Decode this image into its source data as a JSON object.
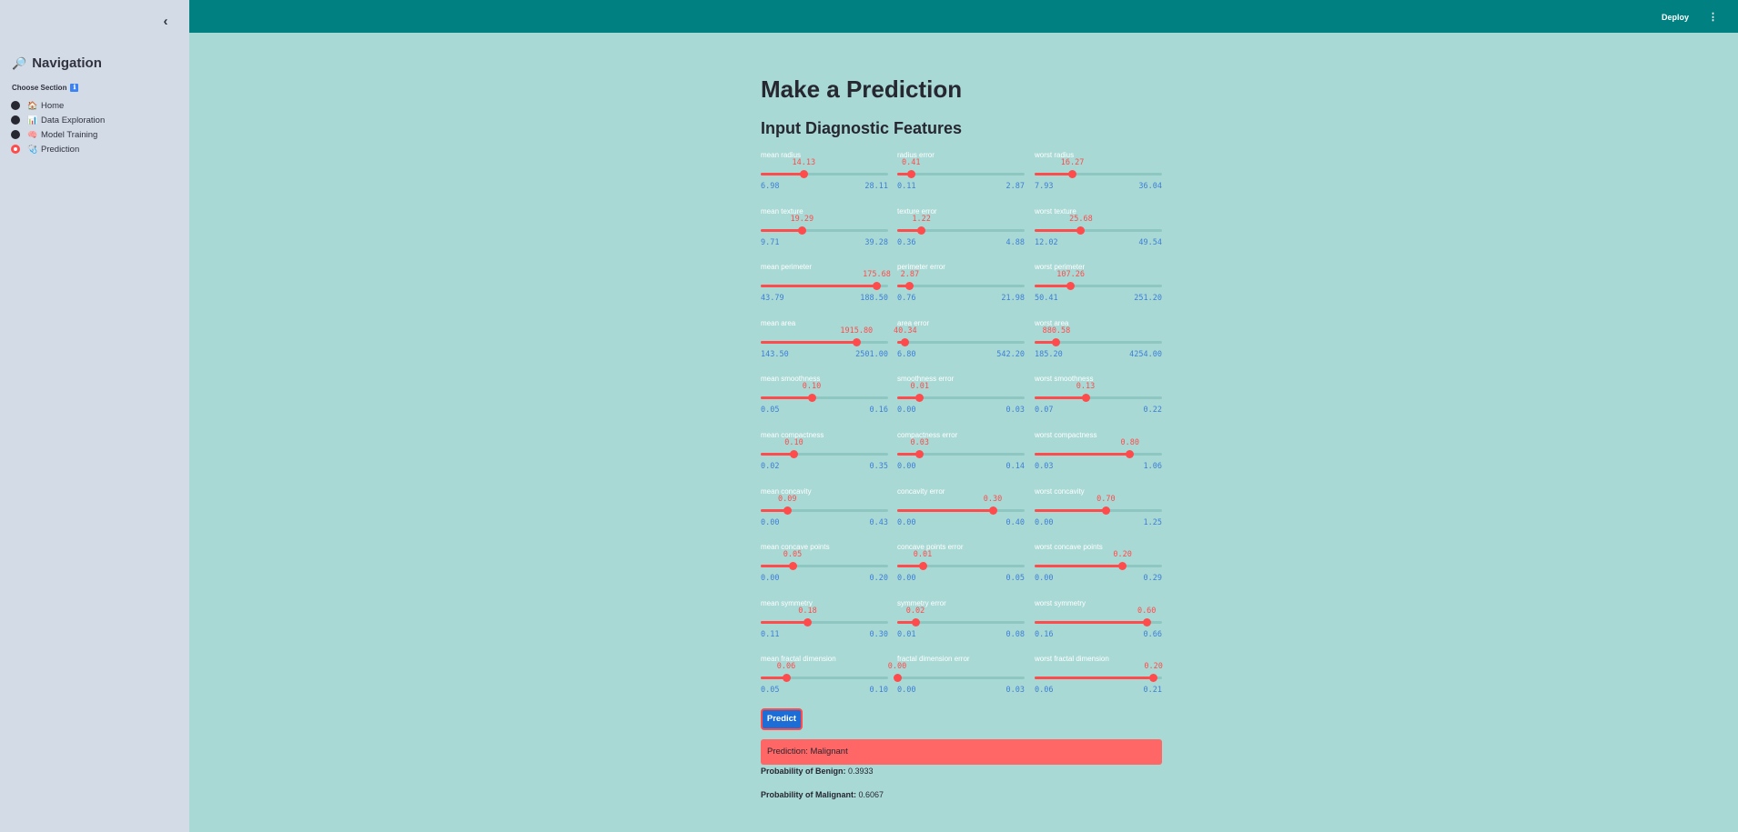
{
  "sidebar": {
    "title": "Navigation",
    "title_icon": "🔎",
    "section_label": "Choose Section",
    "section_badge": "ℹ",
    "items": [
      {
        "emoji": "🏠",
        "label": "Home",
        "active": false
      },
      {
        "emoji": "📊",
        "label": "Data Exploration",
        "active": false
      },
      {
        "emoji": "🧠",
        "label": "Model Training",
        "active": false
      },
      {
        "emoji": "🩺",
        "label": "Prediction",
        "active": true
      }
    ]
  },
  "header": {
    "deploy_label": "Deploy",
    "menu_icon": "⋮"
  },
  "main": {
    "title": "Make a Prediction",
    "subtitle": "Input Diagnostic Features",
    "accent_color": "#ff4b4b",
    "sliders": [
      {
        "label": "mean radius",
        "value": "14.13",
        "min": "6.98",
        "max": "28.11",
        "frac": 0.338
      },
      {
        "label": "radius error",
        "value": "0.41",
        "min": "0.11",
        "max": "2.87",
        "frac": 0.109
      },
      {
        "label": "worst radius",
        "value": "16.27",
        "min": "7.93",
        "max": "36.04",
        "frac": 0.297
      },
      {
        "label": "mean texture",
        "value": "19.29",
        "min": "9.71",
        "max": "39.28",
        "frac": 0.324
      },
      {
        "label": "texture error",
        "value": "1.22",
        "min": "0.36",
        "max": "4.88",
        "frac": 0.19
      },
      {
        "label": "worst texture",
        "value": "25.68",
        "min": "12.02",
        "max": "49.54",
        "frac": 0.364
      },
      {
        "label": "mean perimeter",
        "value": "175.68",
        "min": "43.79",
        "max": "188.50",
        "frac": 0.911
      },
      {
        "label": "perimeter error",
        "value": "2.87",
        "min": "0.76",
        "max": "21.98",
        "frac": 0.099
      },
      {
        "label": "worst perimeter",
        "value": "107.26",
        "min": "50.41",
        "max": "251.20",
        "frac": 0.283
      },
      {
        "label": "mean area",
        "value": "1915.80",
        "min": "143.50",
        "max": "2501.00",
        "frac": 0.752
      },
      {
        "label": "area error",
        "value": "40.34",
        "min": "6.80",
        "max": "542.20",
        "frac": 0.063
      },
      {
        "label": "worst area",
        "value": "880.58",
        "min": "185.20",
        "max": "4254.00",
        "frac": 0.171
      },
      {
        "label": "mean smoothness",
        "value": "0.10",
        "min": "0.05",
        "max": "0.16",
        "frac": 0.4
      },
      {
        "label": "smoothness error",
        "value": "0.01",
        "min": "0.00",
        "max": "0.03",
        "frac": 0.177
      },
      {
        "label": "worst smoothness",
        "value": "0.13",
        "min": "0.07",
        "max": "0.22",
        "frac": 0.4
      },
      {
        "label": "mean compactness",
        "value": "0.10",
        "min": "0.02",
        "max": "0.35",
        "frac": 0.261
      },
      {
        "label": "compactness error",
        "value": "0.03",
        "min": "0.00",
        "max": "0.14",
        "frac": 0.177
      },
      {
        "label": "worst compactness",
        "value": "0.80",
        "min": "0.03",
        "max": "1.06",
        "frac": 0.748
      },
      {
        "label": "mean concavity",
        "value": "0.09",
        "min": "0.00",
        "max": "0.43",
        "frac": 0.209
      },
      {
        "label": "concavity error",
        "value": "0.30",
        "min": "0.00",
        "max": "0.40",
        "frac": 0.75
      },
      {
        "label": "worst concavity",
        "value": "0.70",
        "min": "0.00",
        "max": "1.25",
        "frac": 0.56
      },
      {
        "label": "mean concave points",
        "value": "0.05",
        "min": "0.00",
        "max": "0.20",
        "frac": 0.25
      },
      {
        "label": "concave points error",
        "value": "0.01",
        "min": "0.00",
        "max": "0.05",
        "frac": 0.2
      },
      {
        "label": "worst concave points",
        "value": "0.20",
        "min": "0.00",
        "max": "0.29",
        "frac": 0.69
      },
      {
        "label": "mean symmetry",
        "value": "0.18",
        "min": "0.11",
        "max": "0.30",
        "frac": 0.368
      },
      {
        "label": "symmetry error",
        "value": "0.02",
        "min": "0.01",
        "max": "0.08",
        "frac": 0.143
      },
      {
        "label": "worst symmetry",
        "value": "0.60",
        "min": "0.16",
        "max": "0.66",
        "frac": 0.88
      },
      {
        "label": "mean fractal dimension",
        "value": "0.06",
        "min": "0.05",
        "max": "0.10",
        "frac": 0.2
      },
      {
        "label": "fractal dimension error",
        "value": "0.00",
        "min": "0.00",
        "max": "0.03",
        "frac": 0.0
      },
      {
        "label": "worst fractal dimension",
        "value": "0.20",
        "min": "0.06",
        "max": "0.21",
        "frac": 0.933
      }
    ],
    "predict_label": "Predict",
    "result_text": "Prediction: Malignant",
    "prob_benign_label": "Probability of Benign:",
    "prob_benign_value": "0.3933",
    "prob_malignant_label": "Probability of Malignant:",
    "prob_malignant_value": "0.6067"
  }
}
